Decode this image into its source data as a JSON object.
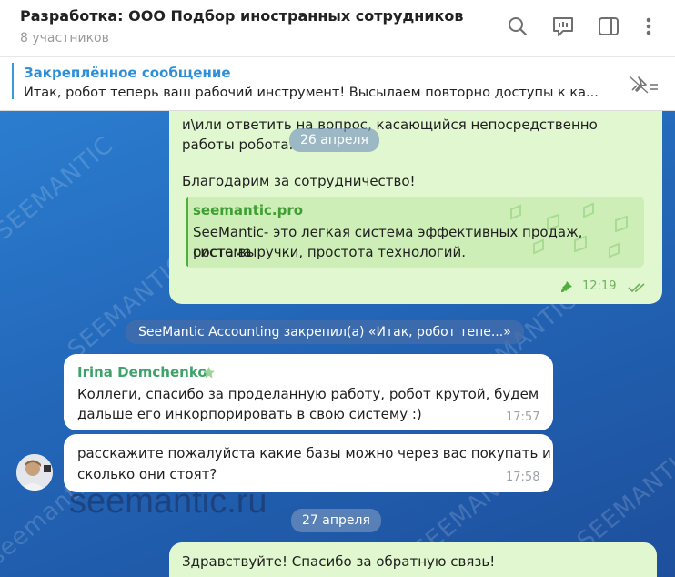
{
  "header": {
    "title": "Разработка: ООО Подбор иностранных сотрудников",
    "subtitle": "8 участников",
    "icons": [
      "search-icon",
      "comments-icon",
      "sidebar-icon",
      "more-icon"
    ]
  },
  "pinned": {
    "title": "Закреплённое сообщение",
    "text": "Итак, робот теперь ваш рабочий инструмент!  Высылаем повторно доступы к ка..."
  },
  "messages": {
    "out1": {
      "line1": "и\\или ответить на вопрос, касающийся непосредственно",
      "line2": "работы робота.",
      "thanks": "Благодарим за сотрудничество!",
      "preview_site": "seemantic.pro",
      "preview_line1": "SeeMantic- это легкая система эффективных продаж, система",
      "preview_line2": "роста выручки, простота технологий.",
      "time": "12:19"
    },
    "date1": "26 апреля",
    "service": "SeeMantic Accounting закрепил(а) «Итак, робот тепе...»",
    "in1": {
      "sender": "Irina Demchenko",
      "line1": "Коллеги, спасибо за проделанную работу, робот крутой, будем",
      "line2": "дальше его инкорпорировать в свою систему :)",
      "time": "17:57"
    },
    "in2": {
      "line1": "расскажите пожалуйста какие базы можно через вас покупать и",
      "line2": "сколько они стоят?",
      "time": "17:58"
    },
    "date2": "27 апреля",
    "out2": {
      "text": "Здравствуйте! Спасибо за обратную связь!"
    }
  },
  "watermarks": [
    "SEEMANTIC",
    "SEEMANTIC",
    "SEEMANTIC",
    "SEEMANTIC",
    "SEEMANTIC",
    "seemantic.ru"
  ],
  "colors": {
    "accent": "#2f8fd6",
    "outgoing": "#e0f7cf",
    "background": "#2366b8",
    "sender": "#3fa26a"
  }
}
